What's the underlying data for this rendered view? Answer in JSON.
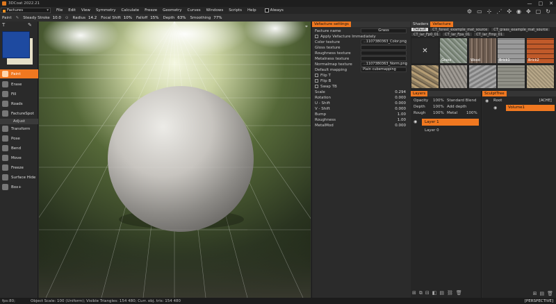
{
  "window": {
    "title": "3DCoat 2022.21",
    "controls": [
      "—",
      "□",
      "✕"
    ]
  },
  "menubar": {
    "room": "Factures",
    "items": [
      "File",
      "Edit",
      "View",
      "Symmetry",
      "Calculate",
      "Freeze",
      "Geometry",
      "Curves",
      "Windows",
      "Scripts",
      "Help"
    ],
    "always_label": "Always"
  },
  "toolbar": {
    "mode": "Paint",
    "steady_label": "Steady Stroke",
    "steady_value": "10.0",
    "radius_label": "Radius",
    "radius_value": "14.2",
    "focal_label": "Focal Shift",
    "focal_value": "10%",
    "falloff_label": "Falloff",
    "falloff_value": "15%",
    "depth_label": "Depth",
    "depth_value": "63%",
    "smoothing_label": "Smoothing",
    "smoothing_value": "77%"
  },
  "colors": {
    "primary": "#1e4aa0",
    "secondary": "#e6e0c8",
    "accent": "#f07820"
  },
  "tools": {
    "top": [
      "Paint",
      "Erase",
      "Fill",
      "Roads",
      "FactureSpot"
    ],
    "adjust_header": "Adjust",
    "adjust": [
      "Transform",
      "Pose",
      "Bend",
      "Move",
      "Freeze",
      "Surface Hide",
      "Box+"
    ]
  },
  "vefacture": {
    "header": "Vefacture settings",
    "facture_name_label": "Facture name",
    "facture_name_value": "Grass",
    "apply_label": "Apply Vefacture Immediately",
    "color_texture_label": "Color texture",
    "color_texture_value": "...1107380363_Color.png",
    "gloss_texture_label": "Gloss texture",
    "roughness_texture_label": "Roughness texture",
    "metalness_texture_label": "Metalness texture",
    "normalmap_texture_label": "Normalmap texture",
    "normalmap_texture_value": "...1107380363_Norm.png",
    "default_mapping_label": "Default mapping",
    "default_mapping_value": "Plain cubemapping",
    "flip_t": "Flip T",
    "flip_b": "Flip B",
    "swap_tb": "Swap TB",
    "params": [
      {
        "label": "Scale",
        "value": "0.294"
      },
      {
        "label": "Rotation",
        "value": "0.000"
      },
      {
        "label": "U - Shift",
        "value": "0.000"
      },
      {
        "label": "V - Shift",
        "value": "0.000"
      },
      {
        "label": "Bump",
        "value": "1.00"
      },
      {
        "label": "Roughness",
        "value": "1.00"
      },
      {
        "label": "MetalMod",
        "value": "0.000"
      }
    ]
  },
  "shaders": {
    "tabs": [
      "Shaders",
      "Vefacture"
    ],
    "subtabs_row1": [
      "Default",
      "CT_forest_example_mat_source",
      "CT_grass_example_mat_source"
    ],
    "subtabs_row2": [
      "CT_lar_Fp0_01",
      "CT_lar_Fpa_01",
      "CT_lar_Fmp_01"
    ],
    "thumbs": [
      "",
      "Grass",
      "Wood",
      "Brick1",
      "Brick2",
      "",
      "",
      "",
      "",
      ""
    ]
  },
  "layers": {
    "header": "Layers",
    "opacity_label": "Opacity",
    "opacity_value": "100%",
    "blend_value": "Standard Blend",
    "depth_label": "Depth",
    "depth_value": "100%",
    "depth_mode": "Add depth",
    "rough_label": "Rough",
    "rough_value": "100%",
    "metal_label": "Metal",
    "metal_value": "100%",
    "items": [
      "Layer 1",
      "Layer 0"
    ]
  },
  "sculpt_tree": {
    "header": "SculptTree",
    "root_label": "Root",
    "root_badge": "[ACHE]",
    "volume_label": "Volume1"
  },
  "statusbar": {
    "fps": "fps:80;",
    "info": "Object Scale: 100 (Uniform); Visible Triangles: 154 480; Curr. obj. tris: 154 480",
    "view": "[PERSPECTIVE]"
  }
}
